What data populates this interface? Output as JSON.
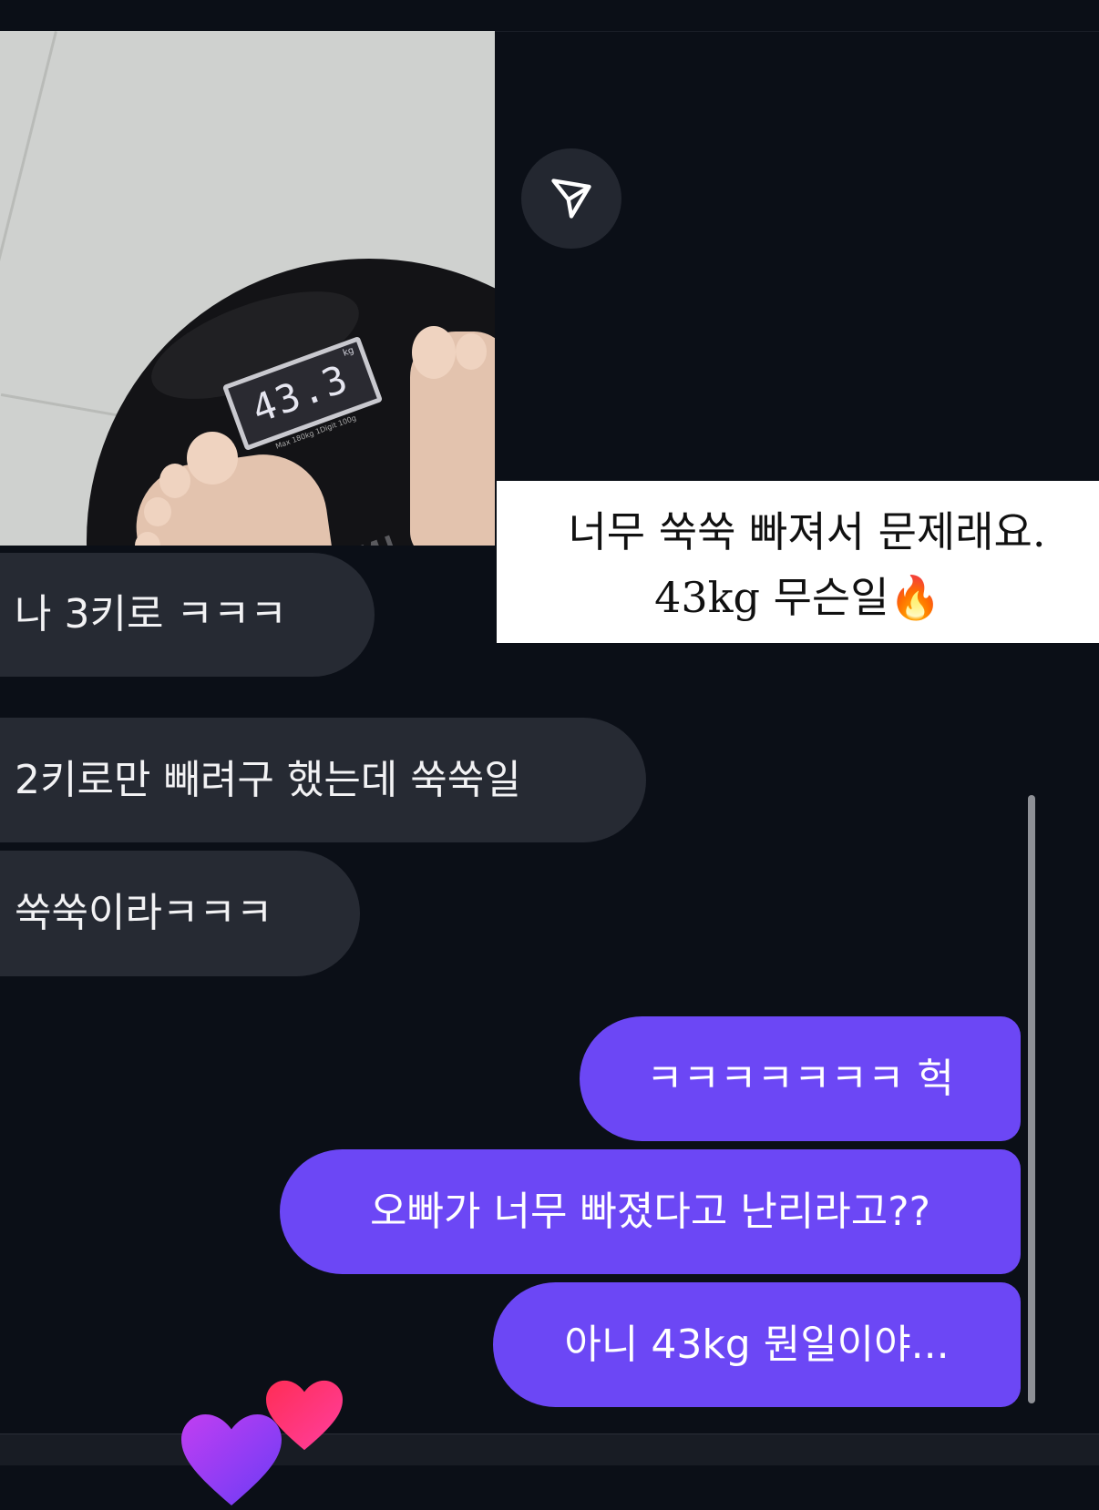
{
  "photo": {
    "scale_reading": "43.3",
    "scale_unit": "kg",
    "scale_small_text": "Max 180kg  1Digit 100g",
    "scale_brand": "MI"
  },
  "caption": {
    "line1": "너무 쑥쑥 빠져서 문제래요.",
    "line2": "43kg 무슨일🔥"
  },
  "messages": {
    "received": [
      "나 3키로 ㅋㅋㅋ",
      "2키로만 빼려구 했는데 쑥쑥일",
      "쑥쑥이라ㅋㅋㅋ"
    ],
    "sent": [
      "ㅋㅋㅋㅋㅋㅋㅋ 헉",
      "오빠가 너무 빠졌다고 난리라고??",
      "아니 43kg 뭔일이야..."
    ]
  },
  "icons": {
    "send": "paper-plane-icon",
    "reaction": "heart-icon"
  },
  "colors": {
    "background": "#0b0f17",
    "received_bubble": "#262a33",
    "sent_bubble": "#6c47f5",
    "heart_pink": "#ff2d7a",
    "heart_purple": "#a63cf0"
  }
}
